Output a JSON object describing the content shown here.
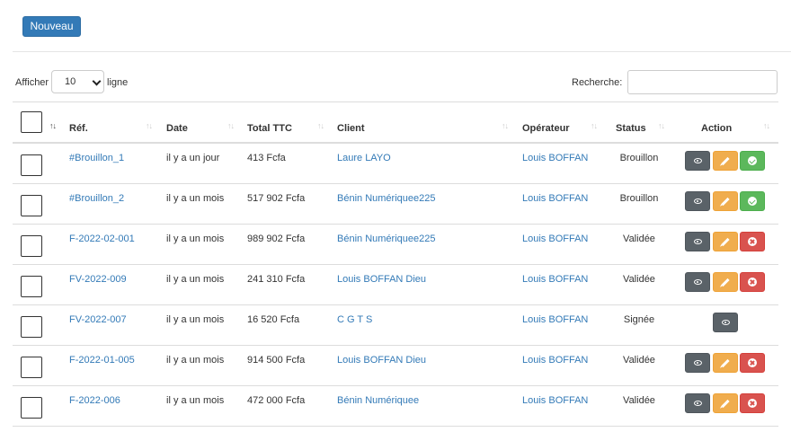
{
  "toolbar": {
    "new_label": "Nouveau"
  },
  "length": {
    "prefix": "Afficher",
    "value": "10",
    "suffix": "ligne"
  },
  "search": {
    "label": "Recherche:",
    "value": ""
  },
  "table": {
    "headers": {
      "ref": "Réf.",
      "date": "Date",
      "total": "Total TTC",
      "client": "Client",
      "operator": "Opérateur",
      "status": "Status",
      "action": "Action"
    },
    "rows": [
      {
        "ref": "#Brouillon_1",
        "date": "il y a un jour",
        "total": "413 Fcfa",
        "client": "Laure LAYO",
        "operator": "Louis BOFFAN",
        "status": "Brouillon"
      },
      {
        "ref": "#Brouillon_2",
        "date": "il y a un mois",
        "total": "517 902 Fcfa",
        "client": "Bénin Numériquee225",
        "operator": "Louis BOFFAN",
        "status": "Brouillon"
      },
      {
        "ref": "F-2022-02-001",
        "date": "il y a un mois",
        "total": "989 902 Fcfa",
        "client": "Bénin Numériquee225",
        "operator": "Louis BOFFAN",
        "status": "Validée"
      },
      {
        "ref": "FV-2022-009",
        "date": "il y a un mois",
        "total": "241 310 Fcfa",
        "client": "Louis BOFFAN Dieu",
        "operator": "Louis BOFFAN",
        "status": "Validée"
      },
      {
        "ref": "FV-2022-007",
        "date": "il y a un mois",
        "total": "16 520 Fcfa",
        "client": "C G T S",
        "operator": "Louis BOFFAN",
        "status": "Signée"
      },
      {
        "ref": "F-2022-01-005",
        "date": "il y a un mois",
        "total": "914 500 Fcfa",
        "client": "Louis BOFFAN Dieu",
        "operator": "Louis BOFFAN",
        "status": "Validée"
      },
      {
        "ref": "F-2022-006",
        "date": "il y a un mois",
        "total": "472 000 Fcfa",
        "client": "Bénin Numériquee",
        "operator": "Louis BOFFAN",
        "status": "Validée"
      }
    ]
  },
  "colors": {
    "primary": "#337ab7",
    "view": "#5a6268",
    "edit": "#f0ad4e",
    "validate": "#5cb85c",
    "cancel": "#d9534f"
  }
}
